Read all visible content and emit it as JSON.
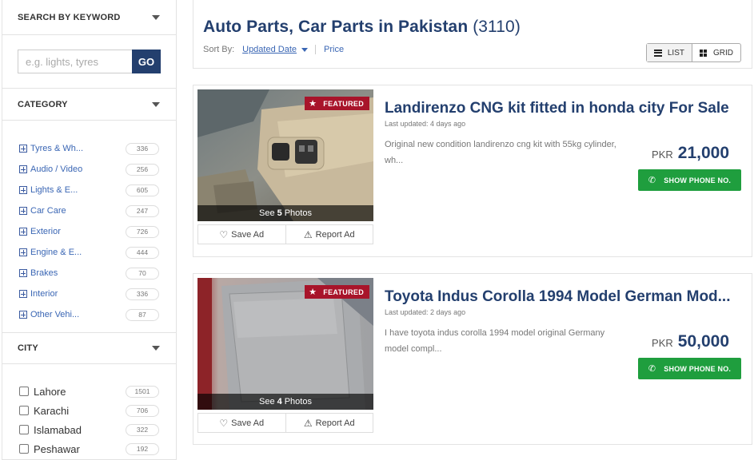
{
  "sidebar": {
    "keyword": {
      "title": "SEARCH BY KEYWORD",
      "placeholder": "e.g. lights, tyres",
      "button": "GO"
    },
    "category": {
      "title": "CATEGORY",
      "items": [
        {
          "label": "Tyres & Wh...",
          "count": "336"
        },
        {
          "label": "Audio / Video",
          "count": "256"
        },
        {
          "label": "Lights & E...",
          "count": "605"
        },
        {
          "label": "Car Care",
          "count": "247"
        },
        {
          "label": "Exterior",
          "count": "726"
        },
        {
          "label": "Engine & E...",
          "count": "444"
        },
        {
          "label": "Brakes",
          "count": "70"
        },
        {
          "label": "Interior",
          "count": "336"
        },
        {
          "label": "Other Vehi...",
          "count": "87"
        }
      ]
    },
    "city": {
      "title": "CITY",
      "items": [
        {
          "label": "Lahore",
          "count": "1501"
        },
        {
          "label": "Karachi",
          "count": "706"
        },
        {
          "label": "Islamabad",
          "count": "322"
        },
        {
          "label": "Peshawar",
          "count": "192"
        }
      ]
    }
  },
  "header": {
    "title": "Auto Parts, Car Parts in Pakistan",
    "count": "(3110)",
    "sort_label": "Sort By:",
    "sort_selected": "Updated Date",
    "sort_other": "Price",
    "view_list": "LIST",
    "view_grid": "GRID"
  },
  "ads": [
    {
      "title": "Landirenzo CNG kit fitted in honda city For Sale",
      "updated": "Last updated: 4 days ago",
      "desc": "Original new condition landirenzo cng kit with 55kg cylinder, wh...",
      "currency": "PKR",
      "price": "21,000",
      "featured": "FEATURED",
      "photos_pre": "See",
      "photos_num": "5",
      "photos_post": "Photos",
      "save": "Save Ad",
      "report": "Report Ad",
      "phone": "SHOW PHONE NO."
    },
    {
      "title": "Toyota Indus Corolla 1994 Model German Mod...",
      "updated": "Last updated: 2 days ago",
      "desc": "I have toyota indus corolla 1994 model original Germany model compl...",
      "currency": "PKR",
      "price": "50,000",
      "featured": "FEATURED",
      "photos_pre": "See",
      "photos_num": "4",
      "photos_post": "Photos",
      "save": "Save Ad",
      "report": "Report Ad",
      "phone": "SHOW PHONE NO."
    }
  ]
}
